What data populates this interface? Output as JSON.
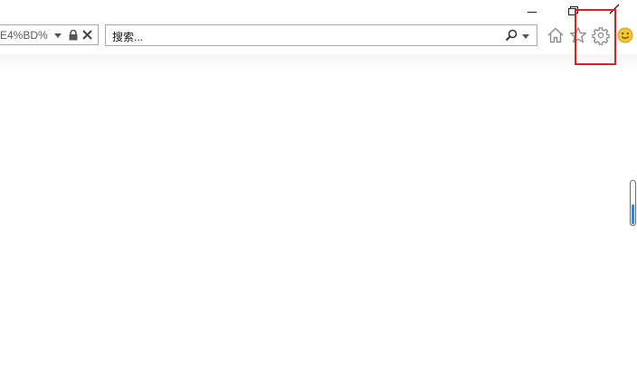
{
  "address_bar": {
    "url_text": "E4%BD%"
  },
  "search": {
    "placeholder": "搜索..."
  },
  "icons": {
    "minimize": "minimize-icon",
    "restore": "restore-icon",
    "close": "close-icon",
    "address_dropdown": "chevron-down-icon",
    "lock": "lock-icon",
    "stop": "close-icon",
    "search": "search-icon",
    "search_dropdown": "chevron-down-icon",
    "home": "home-icon",
    "favorites": "star-icon",
    "tools": "gear-icon",
    "feedback": "smiley-icon"
  },
  "colors": {
    "highlight": "#e02020",
    "scroll_fill": "#3a84d6"
  },
  "scroll_position": 0.43
}
